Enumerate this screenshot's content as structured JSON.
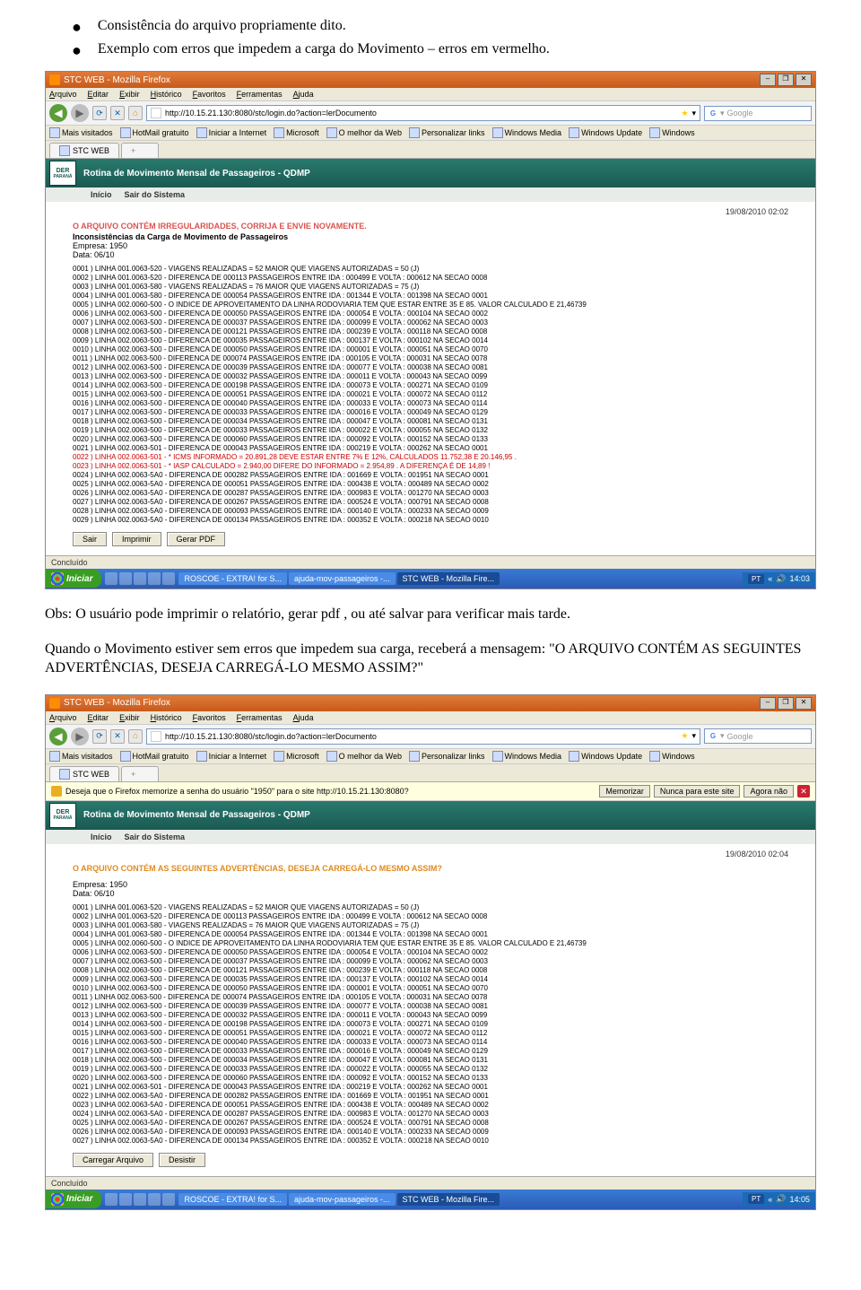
{
  "body_text": {
    "bullet1": "Consistência do arquivo propriamente dito.",
    "bullet2": "Exemplo com erros que impedem a carga do Movimento – erros em vermelho.",
    "obs": "Obs: O usuário pode imprimir o relatório, gerar pdf , ou até salvar para verificar mais tarde.",
    "quando": "Quando o Movimento estiver sem erros que impedem sua carga, receberá a mensagem: \"O ARQUIVO CONTÉM AS SEGUINTES ADVERTÊNCIAS, DESEJA CARREGÁ-LO MESMO ASSIM?\""
  },
  "s1": {
    "window_title": "STC WEB - Mozilla Firefox",
    "menus": [
      "Arquivo",
      "Editar",
      "Exibir",
      "Histórico",
      "Favoritos",
      "Ferramentas",
      "Ajuda"
    ],
    "url": "http://10.15.21.130:8080/stc/login.do?action=lerDocumento",
    "search_placeholder": "Google",
    "bookmarks": [
      "Mais visitados",
      "HotMail gratuito",
      "Iniciar a Internet",
      "Microsoft",
      "O melhor da Web",
      "Personalizar links",
      "Windows Media",
      "Windows Update",
      "Windows"
    ],
    "tab": "STC WEB",
    "app_title": "Rotina de Movimento Mensal de Passageiros - QDMP",
    "nav_items": [
      "Início",
      "Sair do Sistema"
    ],
    "timestamp": "19/08/2010 02:02",
    "error_title": "O ARQUIVO CONTÉM IRREGULARIDADES, CORRIJA E ENVIE NOVAMENTE.",
    "subtitle": "Inconsistências da Carga de Movimento de Passageiros",
    "empresa": "Empresa: 1950",
    "data": "Data: 06/10",
    "lines": [
      "0001 ) LINHA 001.0063-520 - VIAGENS REALIZADAS = 52 MAIOR QUE VIAGENS AUTORIZADAS = 50 (J)",
      "0002 ) LINHA 001.0063-520 - DIFERENCA DE 000113 PASSAGEIROS ENTRE IDA : 000499 E VOLTA : 000612 NA SECAO 0008",
      "0003 ) LINHA 001.0063-580 - VIAGENS REALIZADAS = 76 MAIOR QUE VIAGENS AUTORIZADAS = 75 (J)",
      "0004 ) LINHA 001.0063-580 - DIFERENCA DE 000054 PASSAGEIROS ENTRE IDA : 001344 E VOLTA : 001398 NA SECAO 0001",
      "0005 ) LINHA 002.0060-500 - O INDICE DE APROVEITAMENTO DA LINHA RODOVIARIA TEM QUE ESTAR ENTRE 35 E 85. VALOR CALCULADO E 21,46739",
      "0006 ) LINHA 002.0063-500 - DIFERENCA DE 000050 PASSAGEIROS ENTRE IDA : 000054 E VOLTA : 000104 NA SECAO 0002",
      "0007 ) LINHA 002.0063-500 - DIFERENCA DE 000037 PASSAGEIROS ENTRE IDA : 000099 E VOLTA : 000062 NA SECAO 0003",
      "0008 ) LINHA 002.0063-500 - DIFERENCA DE 000121 PASSAGEIROS ENTRE IDA : 000239 E VOLTA : 000118 NA SECAO 0008",
      "0009 ) LINHA 002.0063-500 - DIFERENCA DE 000035 PASSAGEIROS ENTRE IDA : 000137 E VOLTA : 000102 NA SECAO 0014",
      "0010 ) LINHA 002.0063-500 - DIFERENCA DE 000050 PASSAGEIROS ENTRE IDA : 000001 E VOLTA : 000051 NA SECAO 0070",
      "0011 ) LINHA 002.0063-500 - DIFERENCA DE 000074 PASSAGEIROS ENTRE IDA : 000105 E VOLTA : 000031 NA SECAO 0078",
      "0012 ) LINHA 002.0063-500 - DIFERENCA DE 000039 PASSAGEIROS ENTRE IDA : 000077 E VOLTA : 000038 NA SECAO 0081",
      "0013 ) LINHA 002.0063-500 - DIFERENCA DE 000032 PASSAGEIROS ENTRE IDA : 000011 E VOLTA : 000043 NA SECAO 0099",
      "0014 ) LINHA 002.0063-500 - DIFERENCA DE 000198 PASSAGEIROS ENTRE IDA : 000073 E VOLTA : 000271 NA SECAO 0109",
      "0015 ) LINHA 002.0063-500 - DIFERENCA DE 000051 PASSAGEIROS ENTRE IDA : 000021 E VOLTA : 000072 NA SECAO 0112",
      "0016 ) LINHA 002.0063-500 - DIFERENCA DE 000040 PASSAGEIROS ENTRE IDA : 000033 E VOLTA : 000073 NA SECAO 0114",
      "0017 ) LINHA 002.0063-500 - DIFERENCA DE 000033 PASSAGEIROS ENTRE IDA : 000016 E VOLTA : 000049 NA SECAO 0129",
      "0018 ) LINHA 002.0063-500 - DIFERENCA DE 000034 PASSAGEIROS ENTRE IDA : 000047 E VOLTA : 000081 NA SECAO 0131",
      "0019 ) LINHA 002.0063-500 - DIFERENCA DE 000033 PASSAGEIROS ENTRE IDA : 000022 E VOLTA : 000055 NA SECAO 0132",
      "0020 ) LINHA 002.0063-500 - DIFERENCA DE 000060 PASSAGEIROS ENTRE IDA : 000092 E VOLTA : 000152 NA SECAO 0133",
      "0021 ) LINHA 002.0063-501 - DIFERENCA DE 000043 PASSAGEIROS ENTRE IDA : 000219 E VOLTA : 000262 NA SECAO 0001"
    ],
    "red_lines": [
      "0022 ) LINHA 002.0063-501 - * ICMS INFORMADO = 20.891,28 DEVE ESTAR ENTRE 7% E 12%, CALCULADOS 11.752,38 E 20.146,95 .",
      "0023 ) LINHA 002.0063-501 - * IASP CALCULADO = 2.940,00 DIFERE DO INFORMADO = 2.954,89 . A DIFERENÇA É DE 14,89 !"
    ],
    "lines_after": [
      "0024 ) LINHA 002.0063-5A0 - DIFERENCA DE 000282 PASSAGEIROS ENTRE IDA : 001669 E VOLTA : 001951 NA SECAO 0001",
      "0025 ) LINHA 002.0063-5A0 - DIFERENCA DE 000051 PASSAGEIROS ENTRE IDA : 000438 E VOLTA : 000489 NA SECAO 0002",
      "0026 ) LINHA 002.0063-5A0 - DIFERENCA DE 000287 PASSAGEIROS ENTRE IDA : 000983 E VOLTA : 001270 NA SECAO 0003",
      "0027 ) LINHA 002.0063-5A0 - DIFERENCA DE 000267 PASSAGEIROS ENTRE IDA : 000524 E VOLTA : 000791 NA SECAO 0008",
      "0028 ) LINHA 002.0063-5A0 - DIFERENCA DE 000093 PASSAGEIROS ENTRE IDA : 000140 E VOLTA : 000233 NA SECAO 0009",
      "0029 ) LINHA 002.0063-5A0 - DIFERENCA DE 000134 PASSAGEIROS ENTRE IDA : 000352 E VOLTA : 000218 NA SECAO 0010"
    ],
    "buttons": [
      "Sair",
      "Imprimir",
      "Gerar PDF"
    ],
    "status": "Concluído",
    "taskbar": {
      "start": "Iniciar",
      "items": [
        "ROSCOE - EXTRA! for S...",
        "ajuda-mov-passageiros -...",
        "STC WEB - Mozilla Fire..."
      ],
      "lang": "PT",
      "time": "14:03"
    }
  },
  "s2": {
    "window_title": "STC WEB - Mozilla Firefox",
    "menus": [
      "Arquivo",
      "Editar",
      "Exibir",
      "Histórico",
      "Favoritos",
      "Ferramentas",
      "Ajuda"
    ],
    "url": "http://10.15.21.130:8080/stc/login.do?action=lerDocumento",
    "search_placeholder": "Google",
    "bookmarks": [
      "Mais visitados",
      "HotMail gratuito",
      "Iniciar a Internet",
      "Microsoft",
      "O melhor da Web",
      "Personalizar links",
      "Windows Media",
      "Windows Update",
      "Windows"
    ],
    "tab": "STC WEB",
    "pw_prompt": "Deseja que o Firefox memorize a senha do usuário \"1950\" para o site http://10.15.21.130:8080?",
    "pw_buttons": [
      "Memorizar",
      "Nunca para este site",
      "Agora não"
    ],
    "app_title": "Rotina de Movimento Mensal de Passageiros - QDMP",
    "nav_items": [
      "Início",
      "Sair do Sistema"
    ],
    "timestamp": "19/08/2010 02:04",
    "warn_title": "O ARQUIVO CONTÉM AS SEGUINTES ADVERTÊNCIAS, DESEJA CARREGÁ-LO MESMO ASSIM?",
    "empresa": "Empresa: 1950",
    "data": "Data: 06/10",
    "lines": [
      "0001 ) LINHA 001.0063-520 - VIAGENS REALIZADAS = 52 MAIOR QUE VIAGENS AUTORIZADAS = 50 (J)",
      "0002 ) LINHA 001.0063-520 - DIFERENCA DE 000113 PASSAGEIROS ENTRE IDA : 000499 E VOLTA : 000612 NA SECAO 0008",
      "0003 ) LINHA 001.0063-580 - VIAGENS REALIZADAS = 76 MAIOR QUE VIAGENS AUTORIZADAS = 75 (J)",
      "0004 ) LINHA 001.0063-580 - DIFERENCA DE 000054 PASSAGEIROS ENTRE IDA : 001344 E VOLTA : 001398 NA SECAO 0001",
      "0005 ) LINHA 002.0060-500 - O INDICE DE APROVEITAMENTO DA LINHA RODOVIARIA TEM QUE ESTAR ENTRE 35 E 85. VALOR CALCULADO E 21,46739",
      "0006 ) LINHA 002.0063-500 - DIFERENCA DE 000050 PASSAGEIROS ENTRE IDA : 000054 E VOLTA : 000104 NA SECAO 0002",
      "0007 ) LINHA 002.0063-500 - DIFERENCA DE 000037 PASSAGEIROS ENTRE IDA : 000099 E VOLTA : 000062 NA SECAO 0003",
      "0008 ) LINHA 002.0063-500 - DIFERENCA DE 000121 PASSAGEIROS ENTRE IDA : 000239 E VOLTA : 000118 NA SECAO 0008",
      "0009 ) LINHA 002.0063-500 - DIFERENCA DE 000035 PASSAGEIROS ENTRE IDA : 000137 E VOLTA : 000102 NA SECAO 0014",
      "0010 ) LINHA 002.0063-500 - DIFERENCA DE 000050 PASSAGEIROS ENTRE IDA : 000001 E VOLTA : 000051 NA SECAO 0070",
      "0011 ) LINHA 002.0063-500 - DIFERENCA DE 000074 PASSAGEIROS ENTRE IDA : 000105 E VOLTA : 000031 NA SECAO 0078",
      "0012 ) LINHA 002.0063-500 - DIFERENCA DE 000039 PASSAGEIROS ENTRE IDA : 000077 E VOLTA : 000038 NA SECAO 0081",
      "0013 ) LINHA 002.0063-500 - DIFERENCA DE 000032 PASSAGEIROS ENTRE IDA : 000011 E VOLTA : 000043 NA SECAO 0099",
      "0014 ) LINHA 002.0063-500 - DIFERENCA DE 000198 PASSAGEIROS ENTRE IDA : 000073 E VOLTA : 000271 NA SECAO 0109",
      "0015 ) LINHA 002.0063-500 - DIFERENCA DE 000051 PASSAGEIROS ENTRE IDA : 000021 E VOLTA : 000072 NA SECAO 0112",
      "0016 ) LINHA 002.0063-500 - DIFERENCA DE 000040 PASSAGEIROS ENTRE IDA : 000033 E VOLTA : 000073 NA SECAO 0114",
      "0017 ) LINHA 002.0063-500 - DIFERENCA DE 000033 PASSAGEIROS ENTRE IDA : 000016 E VOLTA : 000049 NA SECAO 0129",
      "0018 ) LINHA 002.0063-500 - DIFERENCA DE 000034 PASSAGEIROS ENTRE IDA : 000047 E VOLTA : 000081 NA SECAO 0131",
      "0019 ) LINHA 002.0063-500 - DIFERENCA DE 000033 PASSAGEIROS ENTRE IDA : 000022 E VOLTA : 000055 NA SECAO 0132",
      "0020 ) LINHA 002.0063-500 - DIFERENCA DE 000060 PASSAGEIROS ENTRE IDA : 000092 E VOLTA : 000152 NA SECAO 0133",
      "0021 ) LINHA 002.0063-501 - DIFERENCA DE 000043 PASSAGEIROS ENTRE IDA : 000219 E VOLTA : 000262 NA SECAO 0001",
      "0022 ) LINHA 002.0063-5A0 - DIFERENCA DE 000282 PASSAGEIROS ENTRE IDA : 001669 E VOLTA : 001951 NA SECAO 0001",
      "0023 ) LINHA 002.0063-5A0 - DIFERENCA DE 000051 PASSAGEIROS ENTRE IDA : 000438 E VOLTA : 000489 NA SECAO 0002",
      "0024 ) LINHA 002.0063-5A0 - DIFERENCA DE 000287 PASSAGEIROS ENTRE IDA : 000983 E VOLTA : 001270 NA SECAO 0003",
      "0025 ) LINHA 002.0063-5A0 - DIFERENCA DE 000267 PASSAGEIROS ENTRE IDA : 000524 E VOLTA : 000791 NA SECAO 0008",
      "0026 ) LINHA 002.0063-5A0 - DIFERENCA DE 000093 PASSAGEIROS ENTRE IDA : 000140 E VOLTA : 000233 NA SECAO 0009",
      "0027 ) LINHA 002.0063-5A0 - DIFERENCA DE 000134 PASSAGEIROS ENTRE IDA : 000352 E VOLTA : 000218 NA SECAO 0010"
    ],
    "buttons": [
      "Carregar Arquivo",
      "Desistir"
    ],
    "status": "Concluído",
    "taskbar": {
      "start": "Iniciar",
      "items": [
        "ROSCOE - EXTRA! for S...",
        "ajuda-mov-passageiros -...",
        "STC WEB - Mozilla Fire..."
      ],
      "lang": "PT",
      "time": "14:05"
    }
  }
}
